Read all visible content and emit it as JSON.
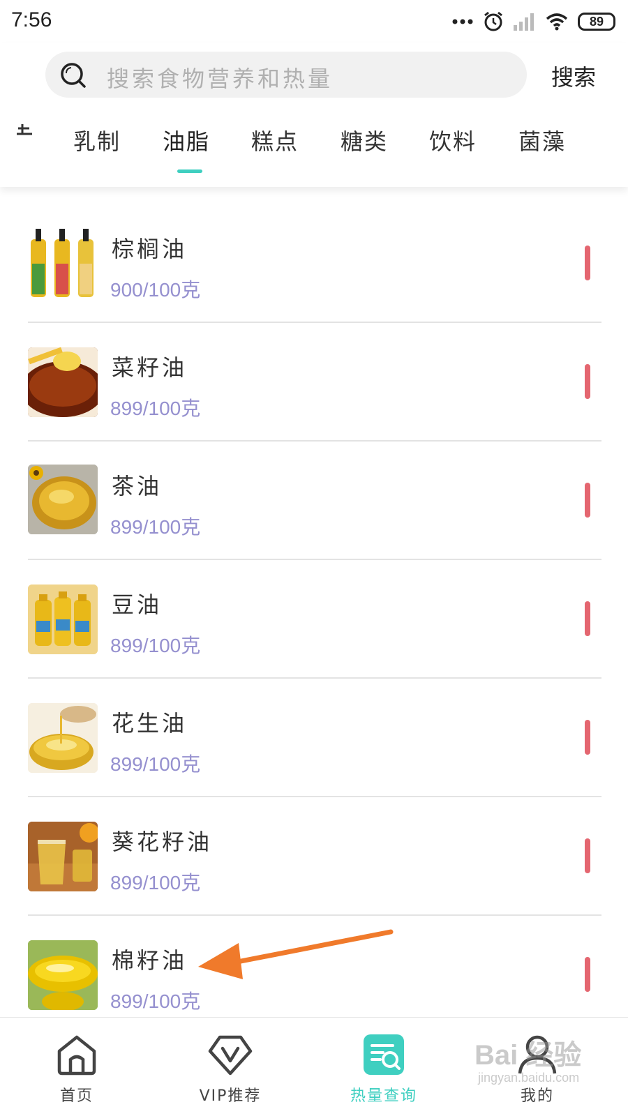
{
  "status_bar": {
    "time": "7:56",
    "battery": "89",
    "icons": [
      "more-dots-icon",
      "alarm-icon",
      "signal-icon",
      "wifi-icon",
      "battery-icon"
    ]
  },
  "search": {
    "placeholder": "搜索食物营养和热量",
    "button_label": "搜索"
  },
  "tabs": {
    "items": [
      "乳制",
      "油脂",
      "糕点",
      "糖类",
      "饮料",
      "菌藻"
    ],
    "active": "油脂"
  },
  "foods": [
    {
      "name": "棕榈油",
      "calories": "900/100克",
      "image": "oil-bottles"
    },
    {
      "name": "菜籽油",
      "calories": "899/100克",
      "image": "rapeseed-oil"
    },
    {
      "name": "茶油",
      "calories": "899/100克",
      "image": "tea-oil"
    },
    {
      "name": "豆油",
      "calories": "899/100克",
      "image": "soybean-oil"
    },
    {
      "name": "花生油",
      "calories": "899/100克",
      "image": "peanut-oil"
    },
    {
      "name": "葵花籽油",
      "calories": "899/100克",
      "image": "sunflower-oil"
    },
    {
      "name": "棉籽油",
      "calories": "899/100克",
      "image": "cottonseed-oil"
    }
  ],
  "bottom_nav": {
    "items": [
      {
        "label": "首页",
        "icon": "home-icon"
      },
      {
        "label": "VIP推荐",
        "icon": "vip-icon"
      },
      {
        "label": "热量查询",
        "icon": "calorie-search-icon"
      },
      {
        "label": "我的",
        "icon": "profile-icon"
      }
    ],
    "active": "热量查询"
  },
  "watermark": {
    "brand": "Bai 经验",
    "url": "jingyan.baidu.com"
  },
  "colors": {
    "accent": "#3fcfc0",
    "calorie_text": "#9590cf",
    "indicator_bar": "#e46670",
    "arrow": "#f07a2b"
  }
}
